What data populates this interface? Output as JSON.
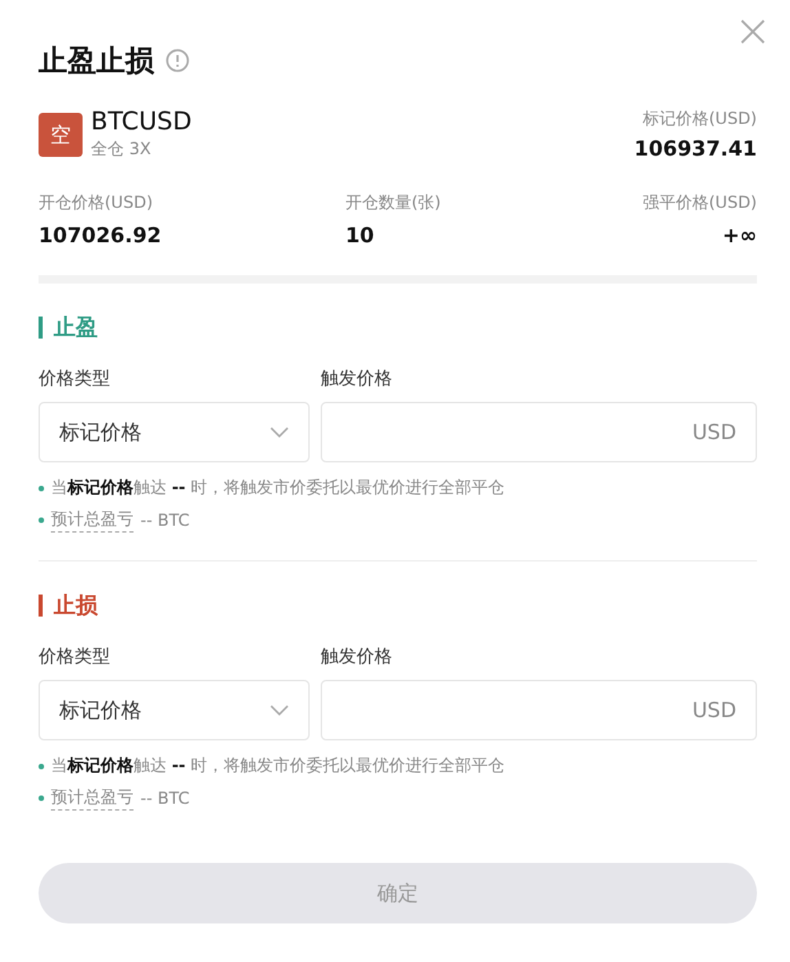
{
  "dialog": {
    "title": "止盈止损"
  },
  "position": {
    "side": "空",
    "symbol": "BTCUSD",
    "mode": "全仓 3X",
    "mark_label": "标记价格(USD)",
    "mark_value": "106937.41"
  },
  "stats": [
    {
      "label": "开仓价格(USD)",
      "value": "107026.92"
    },
    {
      "label": "开仓数量(张)",
      "value": "10"
    },
    {
      "label": "强平价格(USD)",
      "value": "+∞"
    }
  ],
  "sections": [
    {
      "kind": "profit",
      "title": "止盈",
      "type_label": "价格类型",
      "type_value": "标记价格",
      "trigger_label": "触发价格",
      "unit": "USD",
      "hint": "当**标记价格**触达 **--** 时，将触发市价委托以最优价进行全部平仓",
      "estimate_label": "预计总盈亏",
      "estimate_value": "-- BTC"
    },
    {
      "kind": "loss",
      "title": "止损",
      "type_label": "价格类型",
      "type_value": "标记价格",
      "trigger_label": "触发价格",
      "unit": "USD",
      "hint": "当**标记价格**触达 **--** 时，将触发市价委托以最优价进行全部平仓",
      "estimate_label": "预计总盈亏",
      "estimate_value": "-- BTC"
    }
  ],
  "confirm": {
    "label": "确定",
    "disabled": true
  }
}
